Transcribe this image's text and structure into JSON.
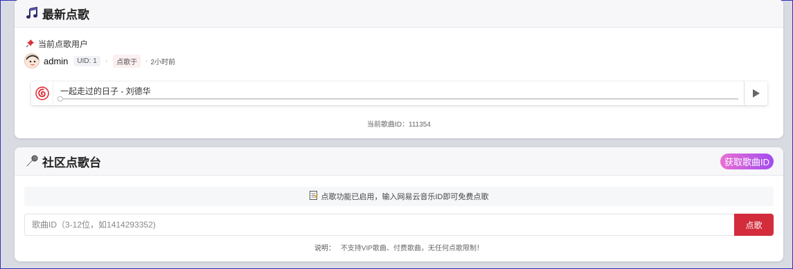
{
  "latest": {
    "title": "最新点歌",
    "icon": "music-note-icon",
    "current_user_label": "当前点歌用户",
    "user": {
      "name": "admin",
      "uid_badge": "UID: 1",
      "action_badge": "点歌于",
      "time": "2小时前"
    },
    "player": {
      "song_title": "一起走过的日子 - 刘德华",
      "progress": 0,
      "brand_color": "#e0262f"
    },
    "song_id_text": "当前歌曲ID：111354"
  },
  "community": {
    "title": "社区点歌台",
    "icon": "microphone-icon",
    "get_id_label": "获取歌曲ID",
    "notice": "点歌功能已启用，输入网易云音乐ID即可免费点歌",
    "input": {
      "placeholder": "歌曲ID（3-12位，如1414293352)",
      "value": ""
    },
    "submit_label": "点歌",
    "footnote_label": "说明：",
    "footnote_text": "不支持VIP歌曲、付费歌曲，无任何点歌限制！"
  },
  "colors": {
    "accent_red": "#d32d3c",
    "gradient_start": "#e96fd2",
    "gradient_end": "#a24cf0"
  }
}
